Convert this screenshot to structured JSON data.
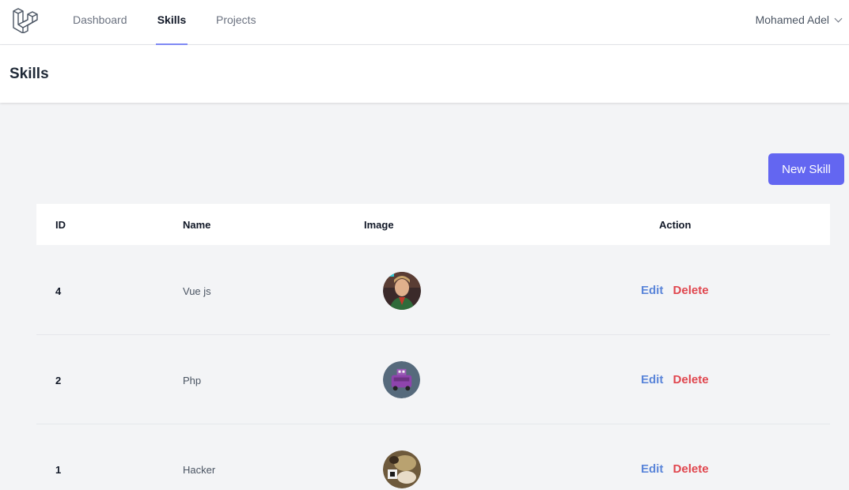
{
  "nav": {
    "links": [
      {
        "label": "Dashboard",
        "active": false
      },
      {
        "label": "Skills",
        "active": true
      },
      {
        "label": "Projects",
        "active": false
      }
    ],
    "user_name": "Mohamed Adel",
    "logo_icon": "laravel-logo-icon"
  },
  "header": {
    "title": "Skills"
  },
  "toolbar": {
    "new_label": "New Skill"
  },
  "table": {
    "columns": {
      "id": "ID",
      "name": "Name",
      "image": "Image",
      "action": "Action"
    },
    "rows": [
      {
        "id": "4",
        "name": "Vue js",
        "image": "person-avatar",
        "edit_label": "Edit",
        "delete_label": "Delete"
      },
      {
        "id": "2",
        "name": "Php",
        "image": "purple-bus-avatar",
        "edit_label": "Edit",
        "delete_label": "Delete"
      },
      {
        "id": "1",
        "name": "Hacker",
        "image": "photo-avatar",
        "edit_label": "Edit",
        "delete_label": "Delete"
      }
    ]
  },
  "colors": {
    "accent": "#6366f1",
    "edit": "#5a85d9",
    "delete": "#e0464e",
    "background": "#f3f4f6"
  }
}
